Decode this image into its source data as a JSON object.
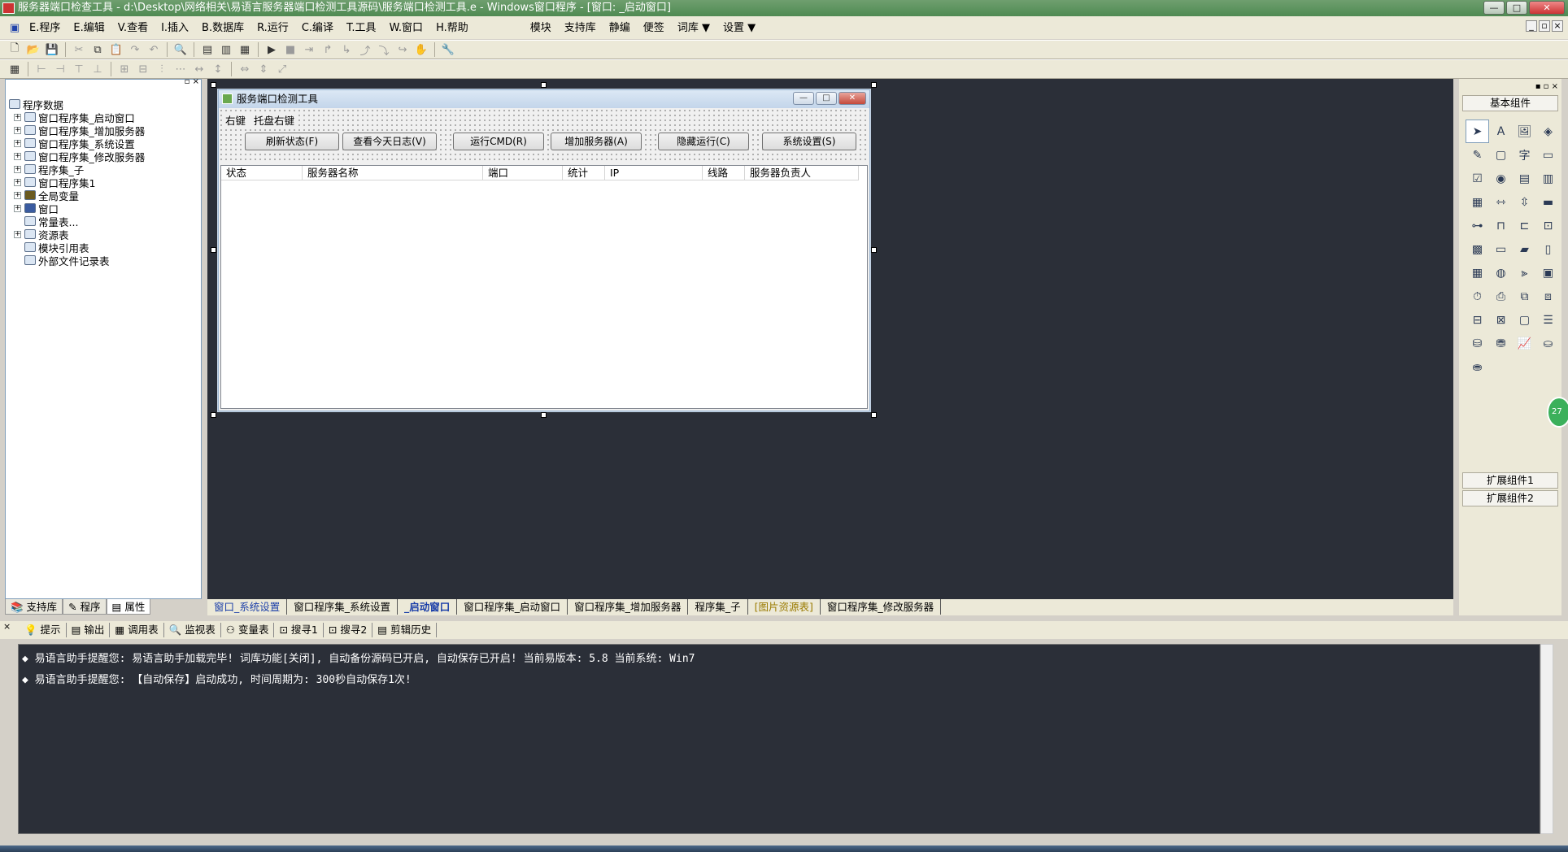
{
  "window": {
    "title": "服务器端口检查工具 - d:\\Desktop\\网络相关\\易语言服务器端口检测工具源码\\服务端口检测工具.e - Windows窗口程序 - [窗口: _启动窗口]",
    "min": "—",
    "max": "□",
    "close": "✕"
  },
  "menu": {
    "items": [
      "E.程序",
      "E.编辑",
      "V.查看",
      "I.插入",
      "B.数据库",
      "R.运行",
      "C.编译",
      "T.工具",
      "W.窗口",
      "H.帮助"
    ],
    "extras": [
      "模块",
      "支持库",
      "静编",
      "便签",
      "词库 ▼",
      "设置 ▼"
    ]
  },
  "left_panel": {
    "tree": [
      {
        "label": "程序数据",
        "plus": false,
        "indent": 0
      },
      {
        "label": "窗口程序集_启动窗口",
        "plus": true,
        "indent": 1
      },
      {
        "label": "窗口程序集_增加服务器",
        "plus": true,
        "indent": 1
      },
      {
        "label": "窗口程序集_系统设置",
        "plus": true,
        "indent": 1
      },
      {
        "label": "窗口程序集_修改服务器",
        "plus": true,
        "indent": 1
      },
      {
        "label": "程序集_子",
        "plus": true,
        "indent": 1
      },
      {
        "label": "窗口程序集1",
        "plus": true,
        "indent": 1
      },
      {
        "label": "全局变量",
        "plus": true,
        "indent": 1
      },
      {
        "label": "窗口",
        "plus": true,
        "indent": 1
      },
      {
        "label": "常量表...",
        "plus": false,
        "indent": 1
      },
      {
        "label": "资源表",
        "plus": true,
        "indent": 1
      },
      {
        "label": "模块引用表",
        "plus": false,
        "indent": 1
      },
      {
        "label": "外部文件记录表",
        "plus": false,
        "indent": 1
      }
    ],
    "tabs": [
      "支持库",
      "程序",
      "属性"
    ]
  },
  "form": {
    "title": "服务端口检测工具",
    "menu": [
      "右键",
      "托盘右键"
    ],
    "buttons": [
      "刷新状态(F)",
      "查看今天日志(V)",
      "运行CMD(R)",
      "增加服务器(A)",
      "隐藏运行(C)",
      "系统设置(S)"
    ],
    "columns": [
      "状态",
      "服务器名称",
      "端口",
      "统计",
      "IP",
      "线路",
      "服务器负责人"
    ]
  },
  "right_panel": {
    "header": "基本组件",
    "footer1": "扩展组件1",
    "footer2": "扩展组件2",
    "bubble": "27"
  },
  "doc_tabs": [
    "窗口_系统设置",
    "窗口程序集_系统设置",
    "_启动窗口",
    "窗口程序集_启动窗口",
    "窗口程序集_增加服务器",
    "程序集_子",
    "[图片资源表]",
    "窗口程序集_修改服务器"
  ],
  "output_tabs": [
    "提示",
    "输出",
    "调用表",
    "监视表",
    "变量表",
    "搜寻1",
    "搜寻2",
    "剪辑历史"
  ],
  "output_lines": [
    "◆ 易语言助手提醒您:  易语言助手加载完毕! 词库功能[关闭], 自动备份源码已开启, 自动保存已开启!  当前易版本: 5.8  当前系统: Win7",
    "◆ 易语言助手提醒您: 【自动保存】启动成功, 时间周期为: 300秒自动保存1次!"
  ]
}
